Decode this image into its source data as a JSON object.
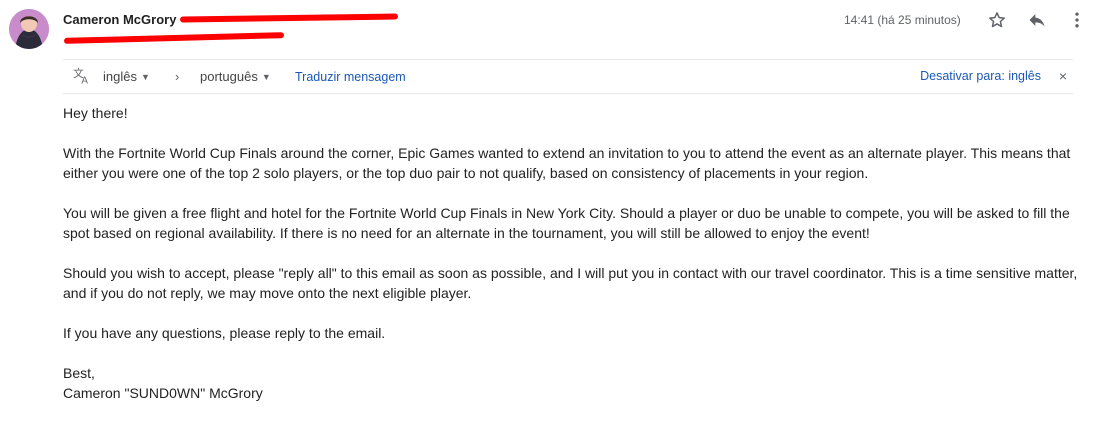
{
  "header": {
    "sender_name": "Cameron McGrory",
    "time": "14:41 (há 25 minutos)",
    "star_icon": "star-outline-icon",
    "reply_icon": "reply-icon",
    "more_icon": "more-vertical-icon"
  },
  "translate_bar": {
    "icon": "translate-icon",
    "from_language": "inglês",
    "to_language": "português",
    "translate_link": "Traduzir mensagem",
    "disable_link": "Desativar para: inglês",
    "close": "×"
  },
  "body": {
    "greeting": "Hey there!",
    "paragraph1": "With the Fortnite World Cup Finals around the corner, Epic Games wanted to extend an invitation to you to attend the event as an alternate player. This means that either you were one of the top 2 solo players, or the top duo pair to not qualify, based on consistency of placements in your region.",
    "paragraph2": "You will be given a free flight and hotel for the Fortnite World Cup Finals in New York City. Should a player or duo be unable to compete, you will be asked to fill the spot based on regional availability. If there is no need for an alternate in the tournament, you will still be allowed to enjoy the event!",
    "paragraph3": "Should you wish to accept, please \"reply all\" to this email as soon as possible, and I will put you in contact with our travel coordinator. This is a time sensitive matter, and if you do not reply, we may move onto the next eligible player.",
    "paragraph4": "If you have any questions, please reply to the email.",
    "signoff": "Best,",
    "signature": "Cameron \"SUND0WN\" McGrory"
  }
}
